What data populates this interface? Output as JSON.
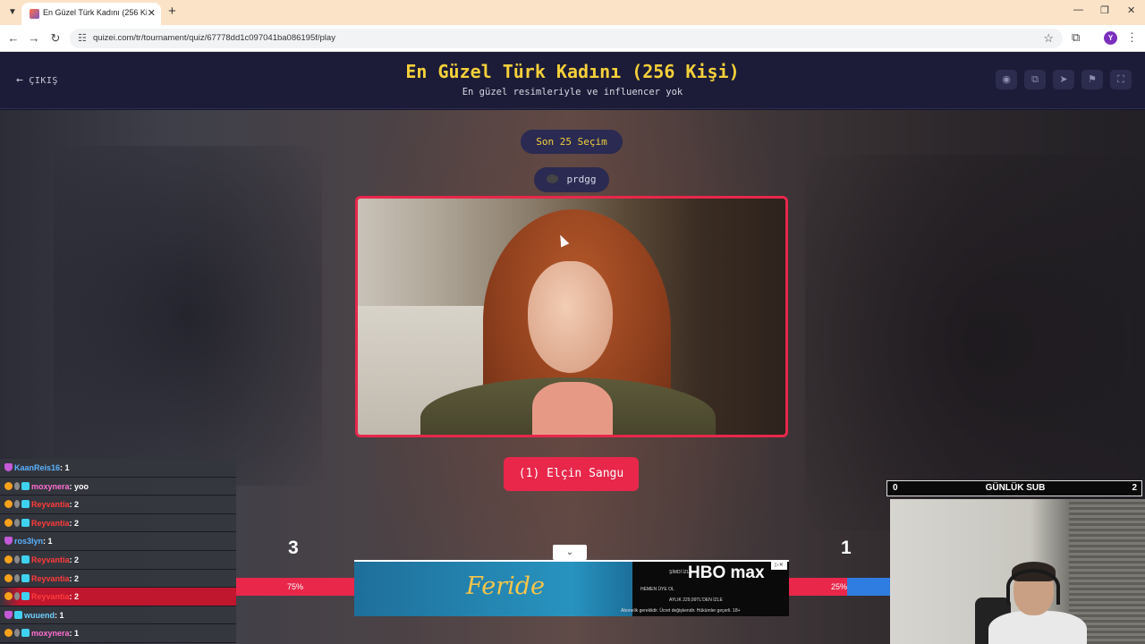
{
  "browser": {
    "tab_title": "En Güzel Türk Kadını (256 Kişi) ·",
    "url": "quizei.com/tr/tournament/quiz/67778dd1c097041ba086195f/play",
    "profile_initial": "Y"
  },
  "header": {
    "exit_label": "ÇIKIŞ",
    "title": "En Güzel Türk Kadını (256 Kişi)",
    "subtitle": "En güzel resimleriyle ve influencer yok"
  },
  "main": {
    "recent_button": "Son 25 Seçim",
    "username": "prdgg",
    "choose_button": "(1) Elçin Sangu",
    "score_left": "3",
    "score_right": "1",
    "percent_left": "75%",
    "percent_right": "25%",
    "percent_left_value": 75,
    "percent_right_value": 25
  },
  "ad": {
    "show": "Feride",
    "brand": "HBO max",
    "line1": "ŞİMDİ İZLE",
    "line2": "HEMEN ÜYE OL",
    "line3": "AYLIK 229,99TL'DEN İZLE",
    "footer": "Abonelik gereklidir. Ücret değişkendir. Hükümler geçerli. 18+"
  },
  "chat": [
    {
      "user": "KaanReis16",
      "msg": "1",
      "color": "nick-blue",
      "badges": [
        "p"
      ]
    },
    {
      "user": "moxynera",
      "msg": "yoo",
      "color": "nick-purple",
      "badges": [
        "o",
        "g",
        "c"
      ]
    },
    {
      "user": "Reyvantia",
      "msg": "2",
      "color": "nick-red",
      "badges": [
        "o",
        "g",
        "c"
      ]
    },
    {
      "user": "Reyvantia",
      "msg": "2",
      "color": "nick-red",
      "badges": [
        "o",
        "g",
        "c"
      ]
    },
    {
      "user": "ros3lyn",
      "msg": "1",
      "color": "nick-blue",
      "badges": [
        "p"
      ]
    },
    {
      "user": "Reyvantia",
      "msg": "2",
      "color": "nick-red",
      "badges": [
        "o",
        "g",
        "c"
      ]
    },
    {
      "user": "Reyvantia",
      "msg": "2",
      "color": "nick-red",
      "badges": [
        "o",
        "g",
        "c"
      ]
    },
    {
      "user": "Reyvantia",
      "msg": "2",
      "color": "nick-red",
      "badges": [
        "o",
        "g",
        "c"
      ],
      "highlight": true
    },
    {
      "user": "wuuend",
      "msg": "1",
      "color": "nick-cyan",
      "badges": [
        "p",
        "c"
      ]
    },
    {
      "user": "moxynera",
      "msg": "1",
      "color": "nick-purple",
      "badges": [
        "o",
        "g",
        "c"
      ]
    }
  ],
  "sub_widget": {
    "left_count": "0",
    "label": "GÜNLÜK SUB",
    "right_count": "2"
  },
  "colors": {
    "accent": "#f5d03a",
    "primary": "#e8274b",
    "header_bg": "#1c1c38",
    "vote_blue": "#2f7de0"
  },
  "icons": {
    "header_buttons": [
      "eye-icon",
      "copy-icon",
      "send-icon",
      "flag-icon",
      "fullscreen-icon"
    ]
  }
}
